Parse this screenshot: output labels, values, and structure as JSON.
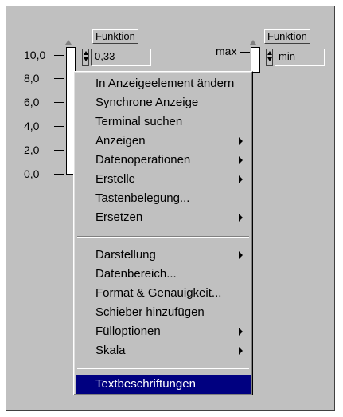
{
  "left_indicator": {
    "label": "Funktion",
    "value": "0,33",
    "scale_ticks": [
      "10,0",
      "8,0",
      "6,0",
      "4,0",
      "2,0",
      "0,0"
    ]
  },
  "right_indicator": {
    "label": "Funktion",
    "value": "min",
    "scale_tick": "max"
  },
  "context_menu": {
    "group1": [
      {
        "label": "In Anzeigeelement ändern"
      },
      {
        "label": "Synchrone Anzeige"
      },
      {
        "label": "Terminal suchen"
      },
      {
        "label": "Anzeigen",
        "submenu": true
      },
      {
        "label": "Datenoperationen",
        "submenu": true
      },
      {
        "label": "Erstelle",
        "submenu": true
      },
      {
        "label": "Tastenbelegung..."
      },
      {
        "label": "Ersetzen",
        "submenu": true
      }
    ],
    "group2": [
      {
        "label": "Darstellung",
        "submenu": true
      },
      {
        "label": "Datenbereich..."
      },
      {
        "label": "Format & Genauigkeit..."
      },
      {
        "label": "Schieber hinzufügen"
      },
      {
        "label": "Fülloptionen",
        "submenu": true
      },
      {
        "label": "Skala",
        "submenu": true
      }
    ],
    "group3": [
      {
        "label": "Textbeschriftungen",
        "selected": true
      }
    ]
  }
}
